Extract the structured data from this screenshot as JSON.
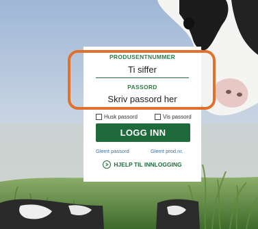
{
  "login": {
    "producer_number_label": "PRODUSENTNUMMER",
    "producer_number_placeholder": "Ti siffer",
    "password_label": "PASSORD",
    "password_placeholder": "Skriv passord her",
    "remember_password_label": "Husk passord",
    "show_password_label": "Vis passord",
    "login_button_label": "LOGG INN",
    "forgot_password_link": "Glemt passord",
    "forgot_producer_number_link": "Glemt prod.nr.",
    "help_link": "HJELP TIL INNLOGGING"
  },
  "colors": {
    "brand_green": "#1f6a3a",
    "field_label_green": "#2d7a45",
    "link_blue": "#3a6e9c",
    "highlight_orange": "#e1702d"
  },
  "icons": {
    "help": "chevron-right-circle-icon"
  }
}
